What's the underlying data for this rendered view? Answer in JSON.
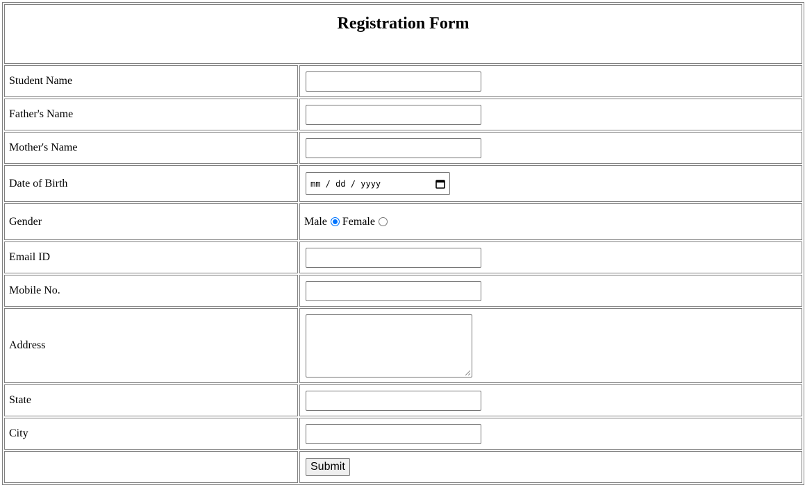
{
  "form": {
    "title": "Registration Form",
    "fields": {
      "student_name": {
        "label": "Student Name",
        "value": ""
      },
      "father_name": {
        "label": "Father's Name",
        "value": ""
      },
      "mother_name": {
        "label": "Mother's Name",
        "value": ""
      },
      "dob": {
        "label": "Date of Birth",
        "placeholder": "mm / dd / yyyy",
        "icon": "calendar-icon"
      },
      "gender": {
        "label": "Gender",
        "options": [
          {
            "label": "Male",
            "checked": true
          },
          {
            "label": "Female",
            "checked": false
          }
        ]
      },
      "email": {
        "label": "Email ID",
        "value": ""
      },
      "mobile": {
        "label": "Mobile No.",
        "value": ""
      },
      "address": {
        "label": "Address",
        "value": ""
      },
      "state": {
        "label": "State",
        "value": ""
      },
      "city": {
        "label": "City",
        "value": ""
      }
    },
    "submit_label": "Submit",
    "colors": {
      "radio_checked": "#0075ff",
      "border": "#808080",
      "button_bg": "#efefef"
    }
  }
}
